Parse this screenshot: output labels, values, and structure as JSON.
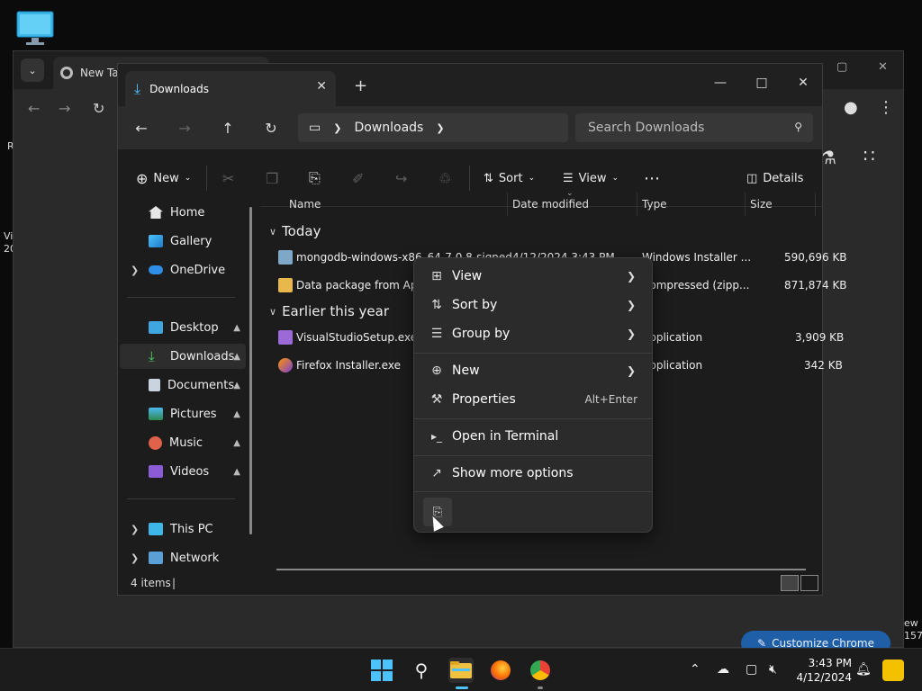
{
  "desktop": {
    "side_text_1": "R",
    "side_text_2": "Vi",
    "side_text_3": "20",
    "right_text_1": "ew",
    "right_text_2": "157"
  },
  "chrome": {
    "tab_title": "New Tab",
    "customize_label": "Customize Chrome"
  },
  "explorer": {
    "tab_title": "Downloads",
    "address": {
      "location": "Downloads"
    },
    "search": {
      "placeholder": "Search Downloads"
    },
    "commands": {
      "new_label": "New",
      "sort_label": "Sort",
      "view_label": "View",
      "details_label": "Details"
    },
    "sidebar": {
      "home": "Home",
      "gallery": "Gallery",
      "onedrive": "OneDrive",
      "desktop": "Desktop",
      "downloads": "Downloads",
      "documents": "Documents",
      "pictures": "Pictures",
      "music": "Music",
      "videos": "Videos",
      "this_pc": "This PC",
      "network": "Network"
    },
    "columns": {
      "name": "Name",
      "date": "Date modified",
      "type": "Type",
      "size": "Size"
    },
    "groups": {
      "today": "Today",
      "earlier": "Earlier this year"
    },
    "files": [
      {
        "name": "mongodb-windows-x86_64-7.0.8-signed",
        "date": "4/12/2024 3:43 PM",
        "type": "Windows Installer ...",
        "size": "590,696 KB"
      },
      {
        "name": "Data package from April",
        "date": "",
        "type": "Compressed (zipp...",
        "size": "871,874 KB"
      },
      {
        "name": "VisualStudioSetup.exe",
        "date": "",
        "type": "Application",
        "size": "3,909 KB"
      },
      {
        "name": "Firefox Installer.exe",
        "date": "",
        "type": "Application",
        "size": "342 KB"
      }
    ],
    "status": {
      "items": "4 items"
    }
  },
  "context_menu": {
    "view": "View",
    "sort_by": "Sort by",
    "group_by": "Group by",
    "new": "New",
    "properties": "Properties",
    "properties_shortcut": "Alt+Enter",
    "open_terminal": "Open in Terminal",
    "show_more": "Show more options"
  },
  "taskbar": {
    "time": "3:43 PM",
    "date": "4/12/2024"
  },
  "colors": {
    "accent": "#4cc2ff",
    "menu_bg": "#2b2b2b",
    "window_bg": "#1c1c1c"
  }
}
